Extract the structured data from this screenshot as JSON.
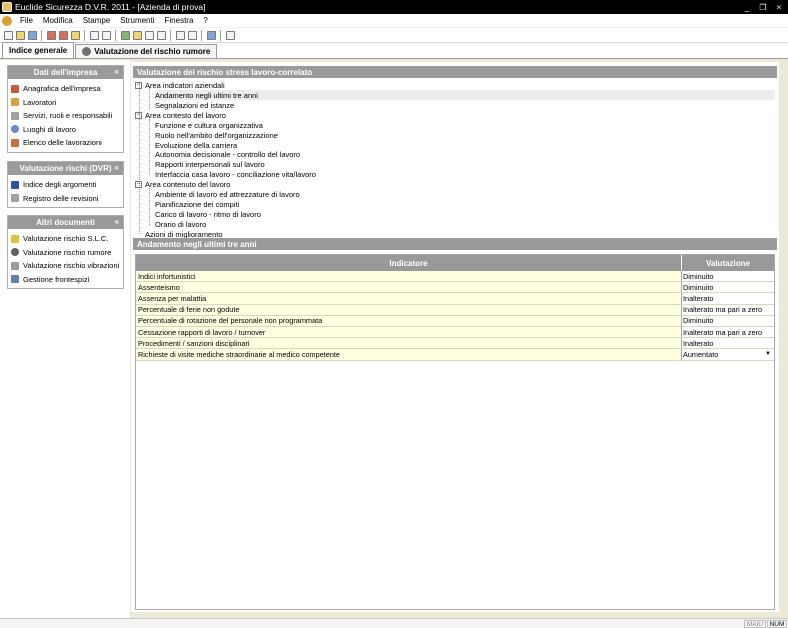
{
  "window": {
    "title": "Euclide Sicurezza D.V.R. 2011 - [Azienda di prova]",
    "minimize": "_",
    "restore": "❐",
    "close": "×"
  },
  "menu": [
    "File",
    "Modifica",
    "Stampe",
    "Strumenti",
    "Finestra",
    "?"
  ],
  "tabs": [
    "Indice generale",
    "Valutazione del rischio rumore"
  ],
  "sidebar": {
    "groups": [
      {
        "title": "Dati dell'impresa",
        "chevron": "«",
        "items": [
          {
            "label": "Anagrafica dell'impresa",
            "icon": "building-icon",
            "color": "#c85a3c"
          },
          {
            "label": "Lavoratori",
            "icon": "workers-icon",
            "color": "#d8a040"
          },
          {
            "label": "Servizi, ruoli e responsabili",
            "icon": "roles-icon",
            "color": "#a0a0a0"
          },
          {
            "label": "Luoghi di lavoro",
            "icon": "globe-icon",
            "color": "#6a8ac8"
          },
          {
            "label": "Elenco delle lavorazioni",
            "icon": "list-icon",
            "color": "#c87040"
          }
        ]
      },
      {
        "title": "Valutazione rischi (DVR)",
        "chevron": "«",
        "items": [
          {
            "label": "Indice degli argomenti",
            "icon": "book-icon",
            "color": "#3050a0"
          },
          {
            "label": "Registro delle revisioni",
            "icon": "register-icon",
            "color": "#a0a0a0"
          }
        ]
      },
      {
        "title": "Altri documenti",
        "chevron": "«",
        "items": [
          {
            "label": "Valutazione rischio S.L.C.",
            "icon": "person-icon",
            "color": "#e0c040"
          },
          {
            "label": "Valutazione rischio rumore",
            "icon": "noise-icon",
            "color": "#606060"
          },
          {
            "label": "Valutazione rischio vibrazioni",
            "icon": "vibration-icon",
            "color": "#9a9a9a"
          },
          {
            "label": "Gestione frontespizi",
            "icon": "document-icon",
            "color": "#6080b0"
          }
        ]
      }
    ]
  },
  "tree": {
    "header": "Valutazione del rischio stress lavoro-correlato",
    "nodes": [
      {
        "label": "Area indicatori aziendali",
        "level": 0,
        "expander": "−"
      },
      {
        "label": "Andamento negli ultimi tre anni",
        "level": 1,
        "selected": true
      },
      {
        "label": "Segnalazioni ed istanze",
        "level": 1
      },
      {
        "label": "Area contesto del lavoro",
        "level": 0,
        "expander": "−"
      },
      {
        "label": "Funzione e cultura organizzativa",
        "level": 1
      },
      {
        "label": "Ruolo nell'ambito dell'organizzazione",
        "level": 1
      },
      {
        "label": "Evoluzione della carriera",
        "level": 1
      },
      {
        "label": "Autonomia decisionale - controllo del lavoro",
        "level": 1
      },
      {
        "label": "Rapporti interpersonali sul lavoro",
        "level": 1
      },
      {
        "label": "Interfaccia casa lavoro - conciliazione vita/lavoro",
        "level": 1
      },
      {
        "label": "Area contenuto del lavoro",
        "level": 0,
        "expander": "−"
      },
      {
        "label": "Ambiente di lavoro ed attrezzature di lavoro",
        "level": 1
      },
      {
        "label": "Pianificazione dei compiti",
        "level": 1
      },
      {
        "label": "Carico di lavoro - ritmo di lavoro",
        "level": 1
      },
      {
        "label": "Orario di lavoro",
        "level": 1
      },
      {
        "label": "Azioni di miglioramento",
        "level": 0
      }
    ]
  },
  "grid": {
    "header": "Andamento negli ultimi tre anni",
    "columns": [
      "Indicatore",
      "Valutazione"
    ],
    "dropdown_glyph": "▼",
    "rows": [
      {
        "indicatore": "Indici infortunistici",
        "valutazione": "Diminuito"
      },
      {
        "indicatore": "Assenteismo",
        "valutazione": "Diminuito"
      },
      {
        "indicatore": "Assenza per malattia",
        "valutazione": "Inalterato"
      },
      {
        "indicatore": "Percentuale di ferie non godute",
        "valutazione": "Inalterato ma pari a zero"
      },
      {
        "indicatore": "Percentuale di rotazione del personale non programmata",
        "valutazione": "Diminuito"
      },
      {
        "indicatore": "Cessazione rapporti di lavoro / turnover",
        "valutazione": "Inalterato ma pari a zero"
      },
      {
        "indicatore": "Procedimenti / sanzioni disciplinari",
        "valutazione": "Inalterato"
      },
      {
        "indicatore": "Richieste di visite mediche straordinarie al medico competente",
        "valutazione": "Aumentato",
        "dropdown": true
      }
    ]
  },
  "status": {
    "maiu": "MAIU",
    "num": "NUM"
  }
}
